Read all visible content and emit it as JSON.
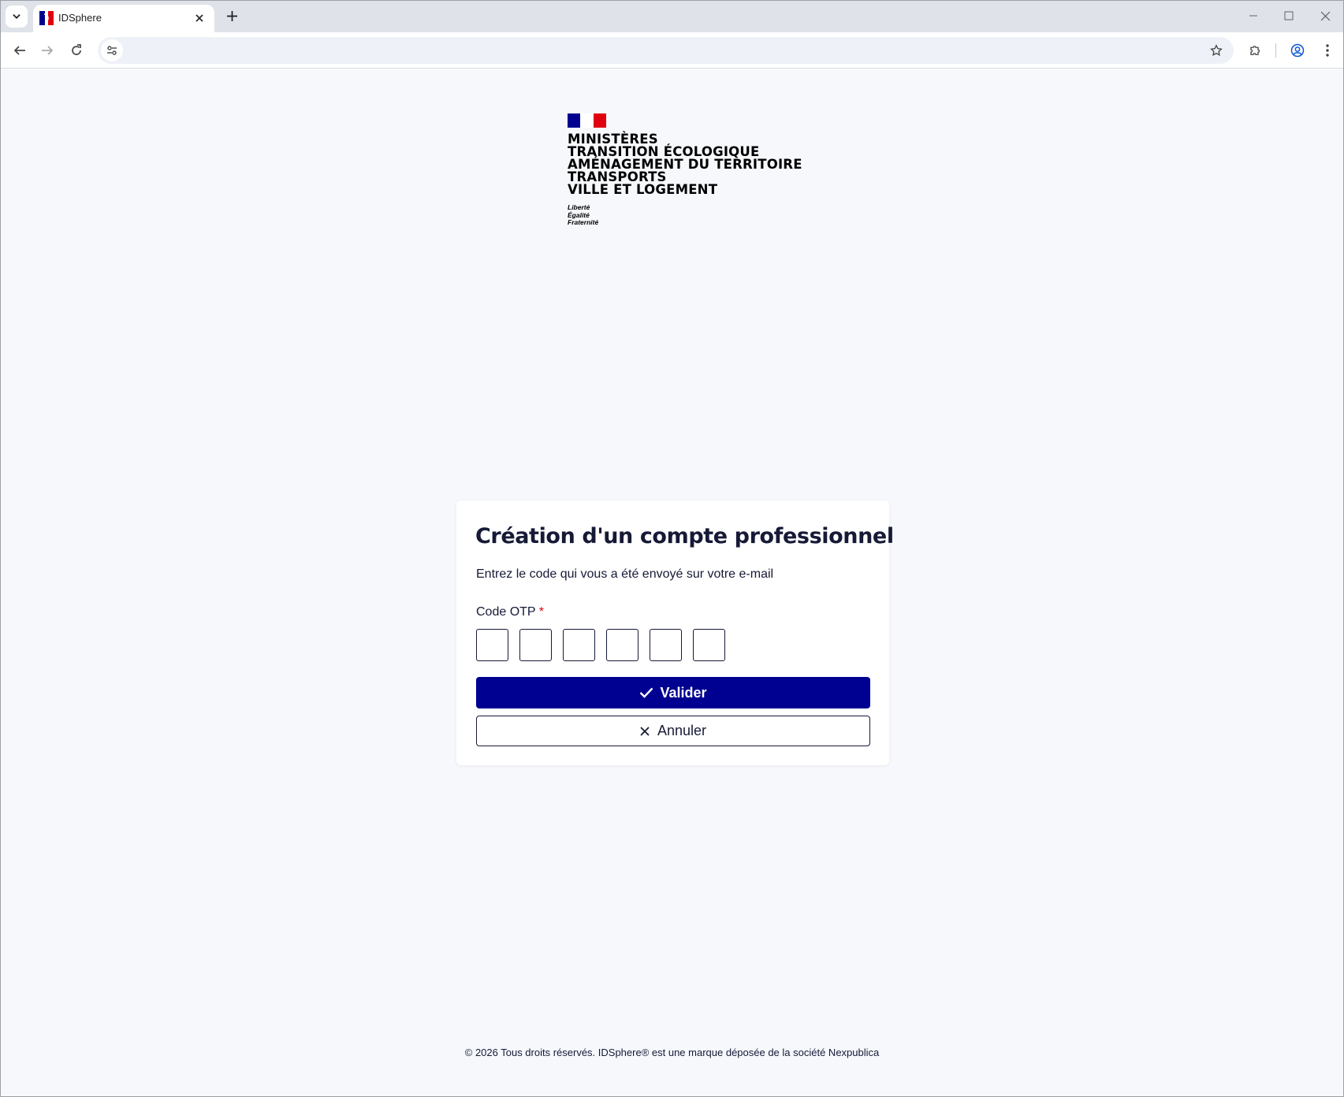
{
  "browser": {
    "tab": {
      "title": "IDSphere",
      "favicon": "marianne-favicon"
    },
    "address_bar": {
      "value": "",
      "placeholder": ""
    },
    "icons": {
      "tab_search": "chevron-down-icon",
      "tab_close": "close-icon",
      "new_tab": "plus-icon",
      "back": "arrow-left-icon",
      "forward": "arrow-right-icon",
      "reload": "reload-icon",
      "site_info": "tune-icon",
      "bookmark": "star-icon",
      "extensions": "puzzle-icon",
      "profile": "account-circle-icon",
      "menu": "kebab-menu-icon",
      "minimize": "minimize-icon",
      "maximize": "maximize-icon",
      "close_window": "close-icon"
    }
  },
  "logo": {
    "flag_colors": [
      "#000091",
      "#ffffff",
      "#e1000f"
    ],
    "ministry_lines": [
      "MINISTÈRES",
      "TRANSITION ÉCOLOGIQUE",
      "AMÉNAGEMENT DU TERRITOIRE",
      "TRANSPORTS",
      "VILLE ET LOGEMENT"
    ],
    "motto": [
      "Liberté",
      "Égalité",
      "Fraternité"
    ]
  },
  "form": {
    "title": "Création d'un compte professionnel",
    "subtitle": "Entrez le code qui vous a été envoyé sur votre e-mail",
    "otp_label": "Code OTP",
    "required_marker": "*",
    "otp_digits": [
      "",
      "",
      "",
      "",
      "",
      ""
    ],
    "validate_label": "Valider",
    "cancel_label": "Annuler"
  },
  "footer": {
    "text": "© 2026 Tous droits réservés. IDSphere® est une marque déposée de la société Nexpublica"
  },
  "colors": {
    "primary": "#000091",
    "text": "#161a36",
    "required": "#e1000f",
    "page_bg": "#f6f8fc"
  }
}
